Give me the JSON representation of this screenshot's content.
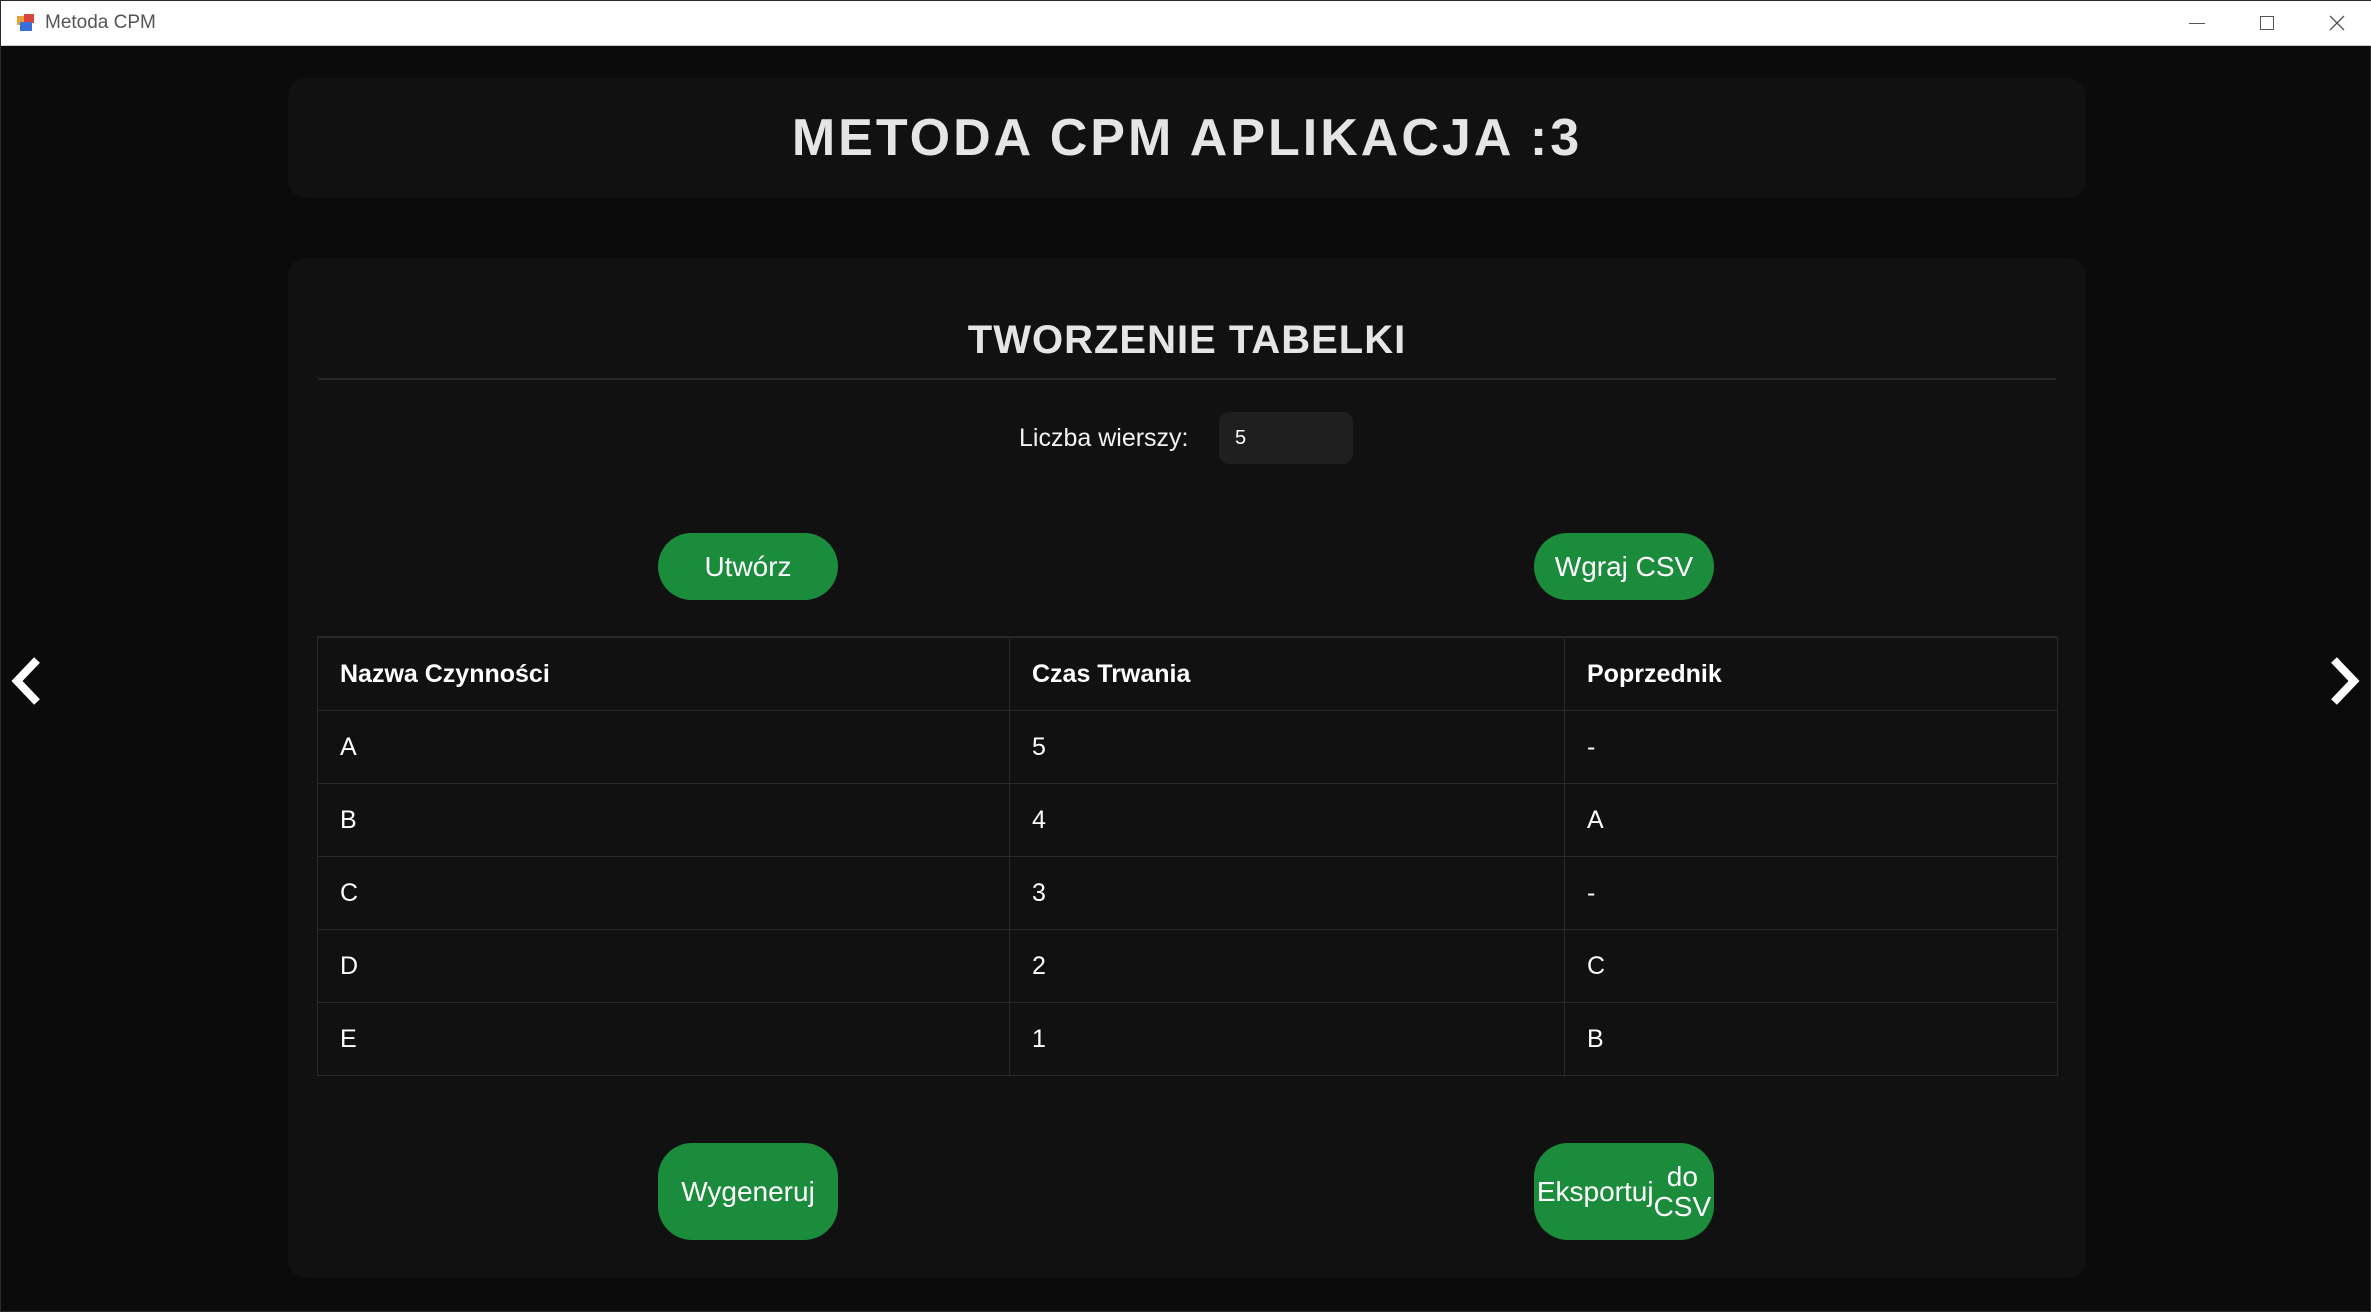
{
  "window": {
    "title": "Metoda CPM"
  },
  "header": {
    "title": "METODA CPM APLIKACJA :3"
  },
  "section": {
    "title": "TWORZENIE TABELKI"
  },
  "rows": {
    "label": "Liczba wierszy:",
    "value": "5"
  },
  "buttons": {
    "create": "Utwórz",
    "upload": "Wgraj CSV",
    "generate": "Wygeneruj",
    "export_line1": "Eksportuj",
    "export_line2": "do CSV"
  },
  "table": {
    "headers": [
      "Nazwa Czynności",
      "Czas Trwania",
      "Poprzednik"
    ],
    "rows": [
      [
        "A",
        "5",
        "-"
      ],
      [
        "B",
        "4",
        "A"
      ],
      [
        "C",
        "3",
        "-"
      ],
      [
        "D",
        "2",
        "C"
      ],
      [
        "E",
        "1",
        "B"
      ]
    ]
  },
  "colors": {
    "accent": "#1a8c3c",
    "background": "#0b0b0b",
    "panel": "#111111"
  },
  "icons": {
    "prev": "chevron-left-icon",
    "next": "chevron-right-icon"
  }
}
